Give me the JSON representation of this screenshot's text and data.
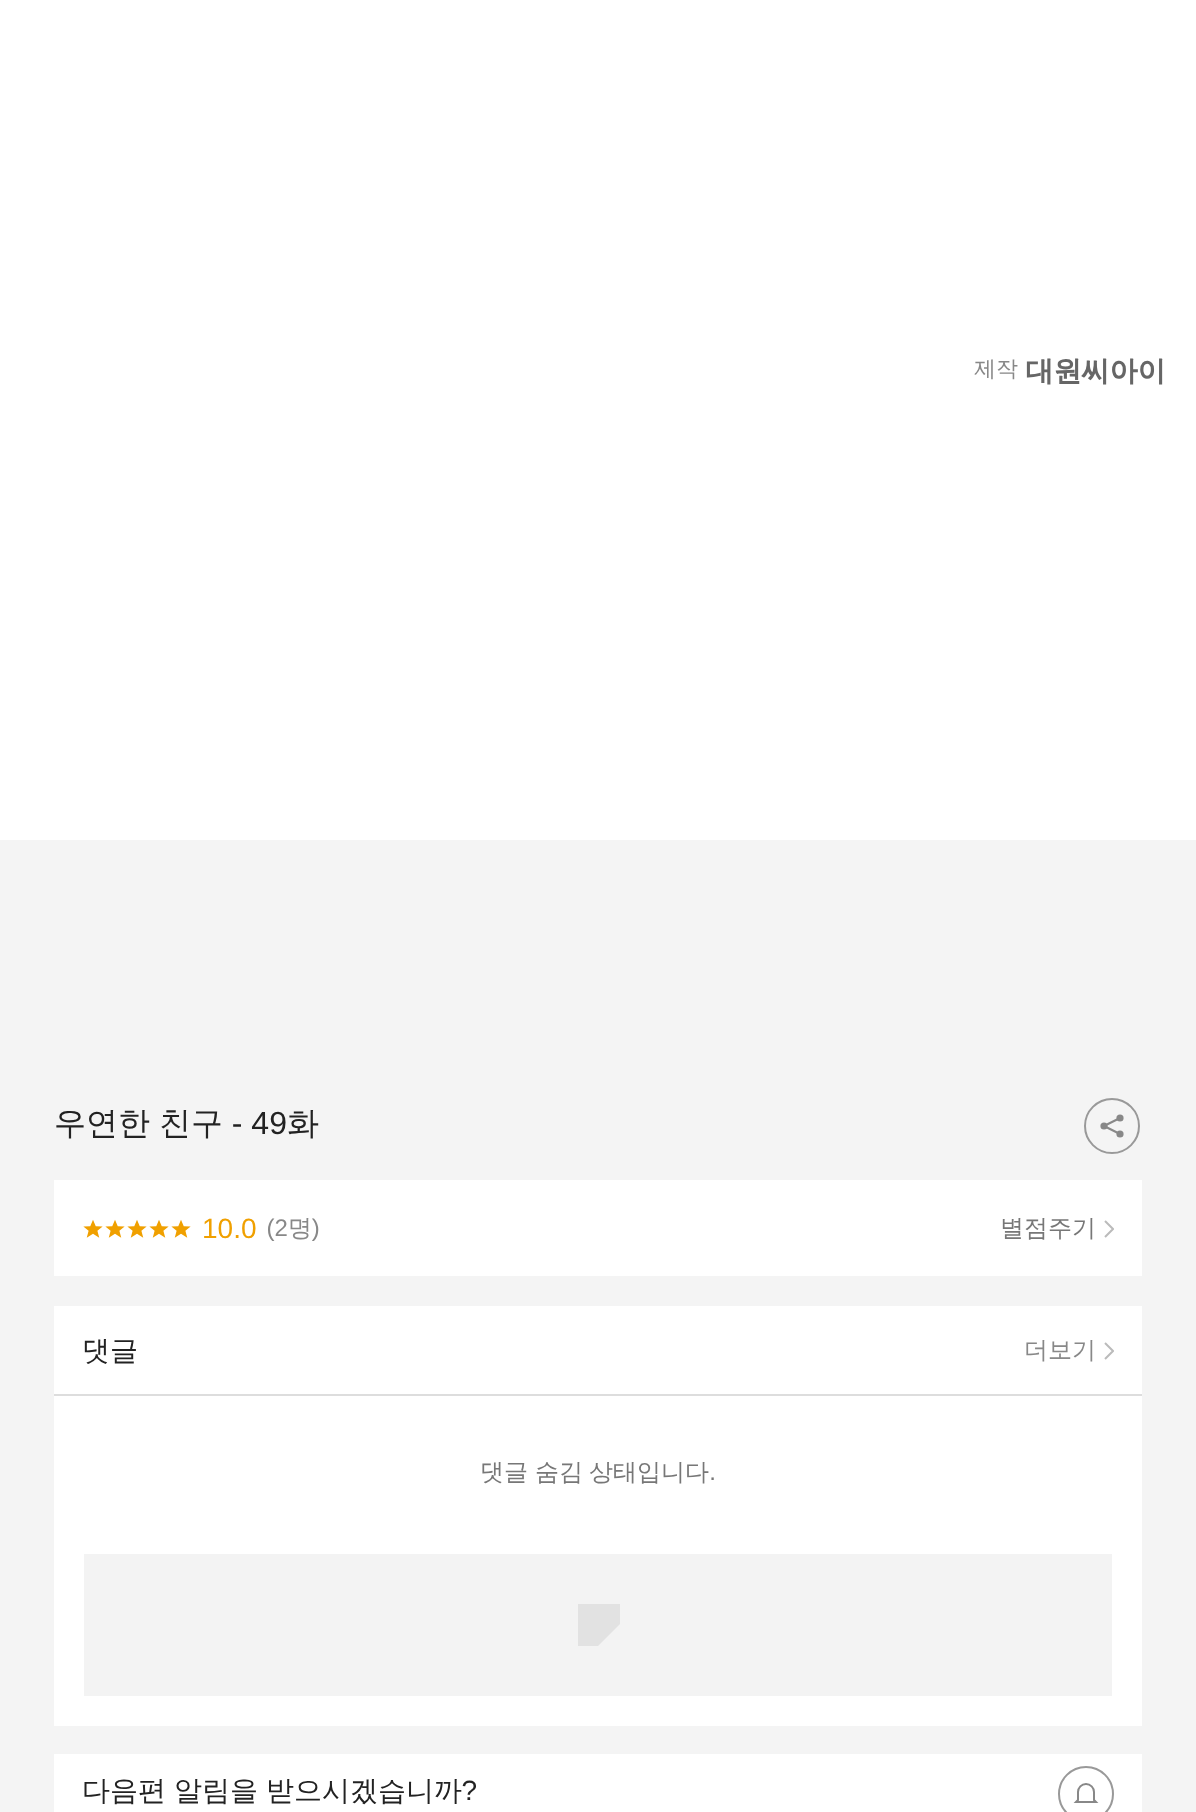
{
  "credit": {
    "label": "제작",
    "name": "대원씨아이"
  },
  "episode": {
    "title": "우연한 친구 - 49화"
  },
  "rating": {
    "stars": 5,
    "score": "10.0",
    "count": "(2명)",
    "action": "별점주기"
  },
  "comments": {
    "title": "댓글",
    "more": "더보기",
    "message": "댓글 숨김 상태입니다."
  },
  "notification": {
    "question": "다음편 알림을 받으시겠습니까?"
  }
}
